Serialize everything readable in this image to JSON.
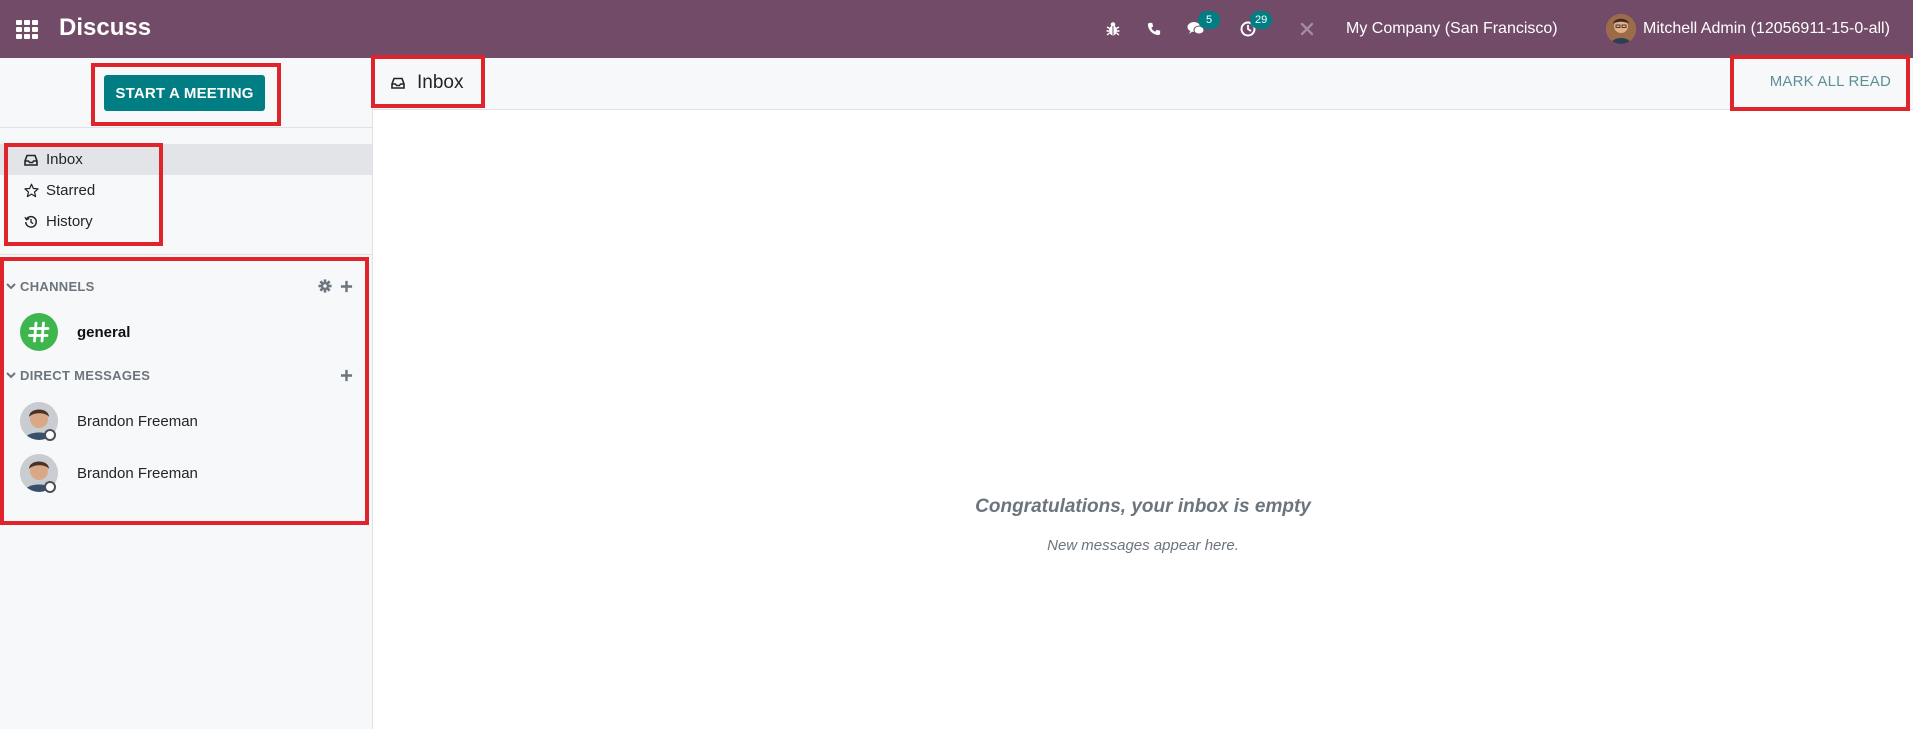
{
  "navbar": {
    "app_title": "Discuss",
    "messages_badge": "5",
    "activities_badge": "29",
    "company": "My Company (San Francisco)",
    "user_name": "Mitchell Admin (12056911-15-0-all)",
    "icons": [
      "apps-grid-icon",
      "bug-icon",
      "phone-icon",
      "chat-icon",
      "clock-icon",
      "close-icon"
    ],
    "color": "#714b67"
  },
  "sidebar": {
    "start_meeting_label": "START A MEETING",
    "mailboxes": [
      {
        "label": "Inbox",
        "icon": "inbox-icon",
        "active": true
      },
      {
        "label": "Starred",
        "icon": "star-icon",
        "active": false
      },
      {
        "label": "History",
        "icon": "history-icon",
        "active": false
      }
    ],
    "channels_header": "CHANNELS",
    "channels": [
      {
        "name": "general"
      }
    ],
    "dm_header": "DIRECT MESSAGES",
    "direct_messages": [
      {
        "name": "Brandon Freeman"
      },
      {
        "name": "Brandon Freeman"
      }
    ]
  },
  "content": {
    "title": "Inbox",
    "mark_all_read": "MARK ALL READ",
    "empty_title": "Congratulations, your inbox is empty",
    "empty_subtitle": "New messages appear here."
  },
  "colors": {
    "brand": "#714b67",
    "accent": "#017e84",
    "highlight": "#e0242b"
  }
}
